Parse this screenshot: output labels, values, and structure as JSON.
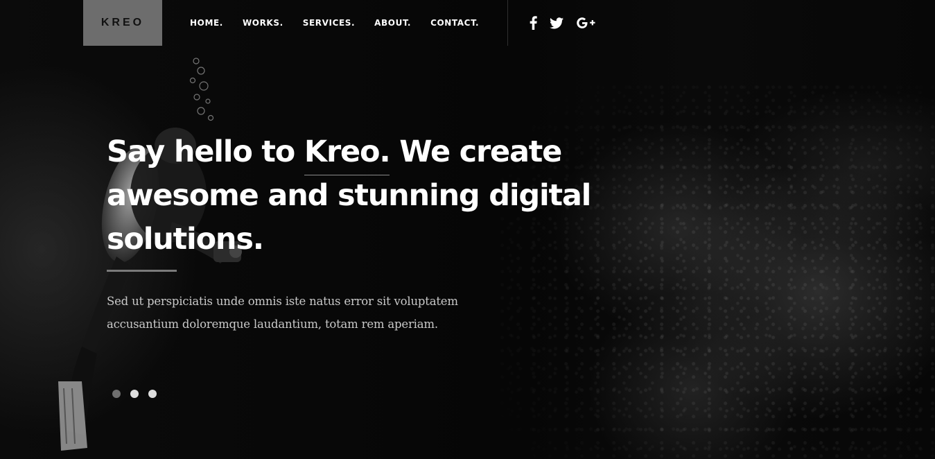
{
  "header": {
    "logo_text": "KREO",
    "nav": [
      {
        "label": "HOME."
      },
      {
        "label": "WORKS."
      },
      {
        "label": "SERVICES."
      },
      {
        "label": "ABOUT."
      },
      {
        "label": "CONTACT."
      }
    ],
    "social": [
      {
        "icon": "facebook-icon",
        "label": "f"
      },
      {
        "icon": "twitter-icon",
        "label": "twitter"
      },
      {
        "icon": "google-plus-icon",
        "label": "G+"
      }
    ]
  },
  "hero": {
    "heading_before": "Say hello to ",
    "heading_brand": "Kreo.",
    "heading_after": " We create awesome and stunning digital solutions.",
    "subtext": "Sed ut perspiciatis unde omnis iste natus error sit voluptatem accusantium doloremque laudantium, totam rem aperiam."
  },
  "slider": {
    "dot_count": 3,
    "active_index": 0
  },
  "colors": {
    "background": "#050505",
    "logo_box": "#6d6d6d",
    "text": "#ffffff",
    "subtext": "#c9c9c9",
    "accent_rule": "#7a7a7a"
  }
}
